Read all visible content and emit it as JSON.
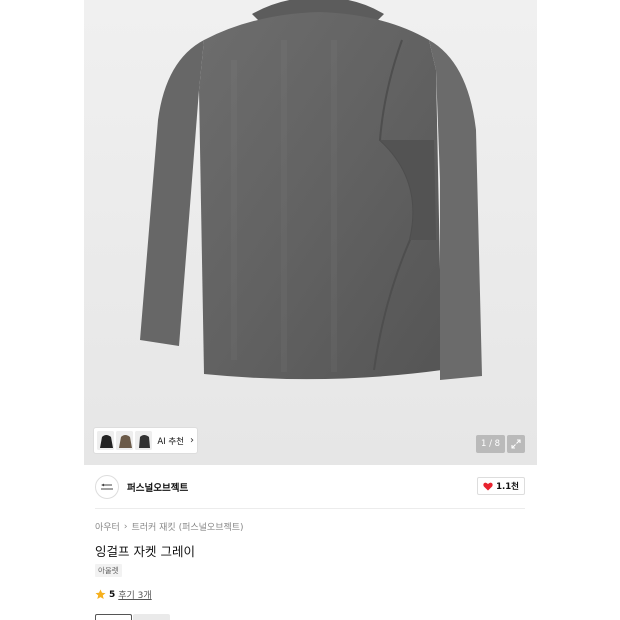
{
  "gallery": {
    "counter": "1 / 8",
    "ai_recommend_label": "AI 추천",
    "expand_icon": "expand-icon"
  },
  "brand": {
    "name": "퍼스널오브젝트",
    "like_count": "1.1천",
    "like_color": "#e8232f"
  },
  "breadcrumb": {
    "items": [
      "아우터",
      "트러커 재킷 (퍼스널오브젝트)"
    ]
  },
  "product": {
    "title": "잉걸프 자켓 그레이",
    "tag": "아울렛",
    "rating": "5",
    "reviews": "후기 3개",
    "star_color": "#f6b01e"
  }
}
